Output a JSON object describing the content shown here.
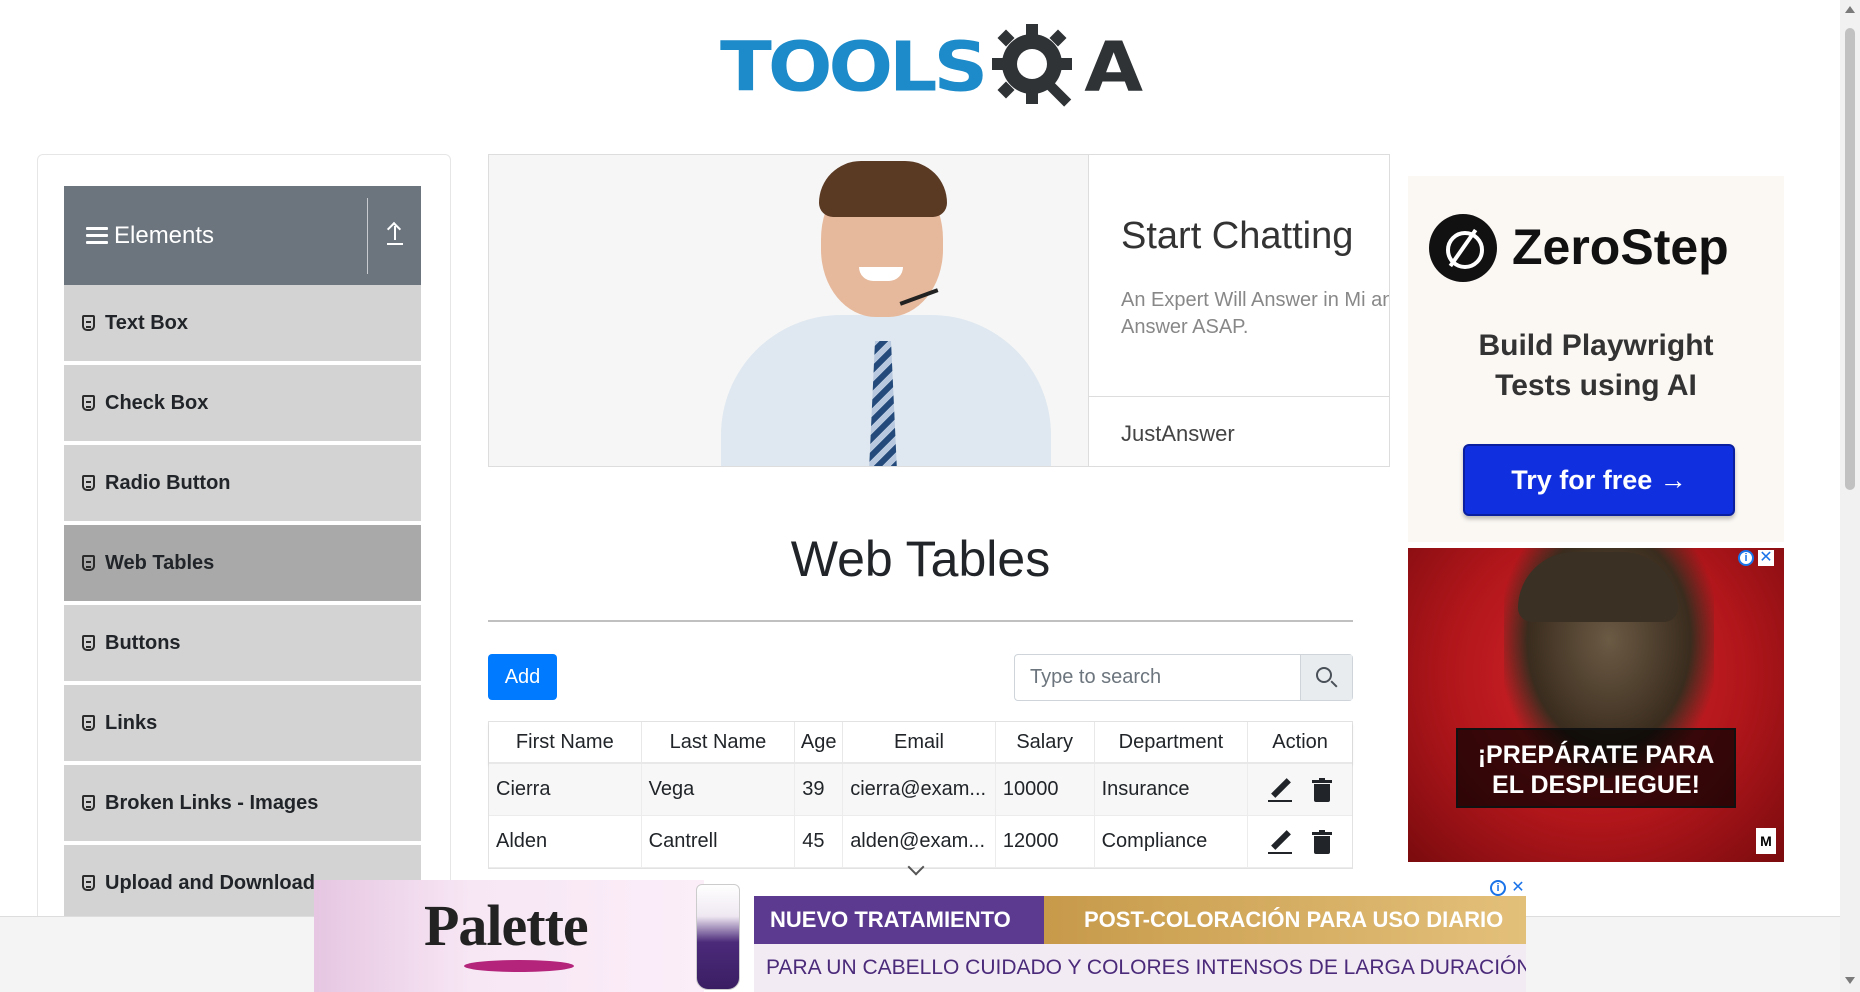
{
  "header": {
    "logo_text": "TOOLS",
    "logo_qa_letter": "A",
    "logo_alt": "TOOLSQA"
  },
  "sidebar": {
    "group_title": "Elements",
    "items": [
      {
        "label": "Text Box",
        "active": false
      },
      {
        "label": "Check Box",
        "active": false
      },
      {
        "label": "Radio Button",
        "active": false
      },
      {
        "label": "Web Tables",
        "active": true
      },
      {
        "label": "Buttons",
        "active": false
      },
      {
        "label": "Links",
        "active": false
      },
      {
        "label": "Broken Links - Images",
        "active": false
      },
      {
        "label": "Upload and Download",
        "active": false
      }
    ]
  },
  "top_ad": {
    "title": "Start Chatting",
    "description": "An Expert Will Answer in Mi an Answer ASAP.",
    "brand": "JustAnswer"
  },
  "main": {
    "page_title": "Web Tables",
    "add_label": "Add",
    "search_placeholder": "Type to search",
    "table": {
      "headers": [
        "First Name",
        "Last Name",
        "Age",
        "Email",
        "Salary",
        "Department",
        "Action"
      ],
      "rows": [
        {
          "first": "Cierra",
          "last": "Vega",
          "age": "39",
          "email": "cierra@exam...",
          "salary": "10000",
          "department": "Insurance"
        },
        {
          "first": "Alden",
          "last": "Cantrell",
          "age": "45",
          "email": "alden@exam...",
          "salary": "12000",
          "department": "Compliance"
        }
      ]
    }
  },
  "right_ads": {
    "zerostep": {
      "name": "ZeroStep",
      "tagline_line1": "Build Playwright",
      "tagline_line2": "Tests using AI",
      "cta": "Try for free →"
    },
    "cod": {
      "line1": "¡PREPÁRATE PARA",
      "line2": "EL DESPLIEGUE!",
      "rating": "M"
    }
  },
  "bottom_ad": {
    "brand": "Palette",
    "band1": "NUEVO TRATAMIENTO",
    "band2": "POST-COLORACIÓN PARA USO DIARIO",
    "sub": "PARA UN CABELLO CUIDADO Y COLORES INTENSOS DE LARGA DURACIÓN"
  },
  "colors": {
    "accent_blue": "#007bff",
    "logo_blue": "#1d8bc9",
    "sidebar_header": "#6c757d",
    "menu_item": "#d3d3d3",
    "menu_item_active": "#a9a9a9"
  }
}
